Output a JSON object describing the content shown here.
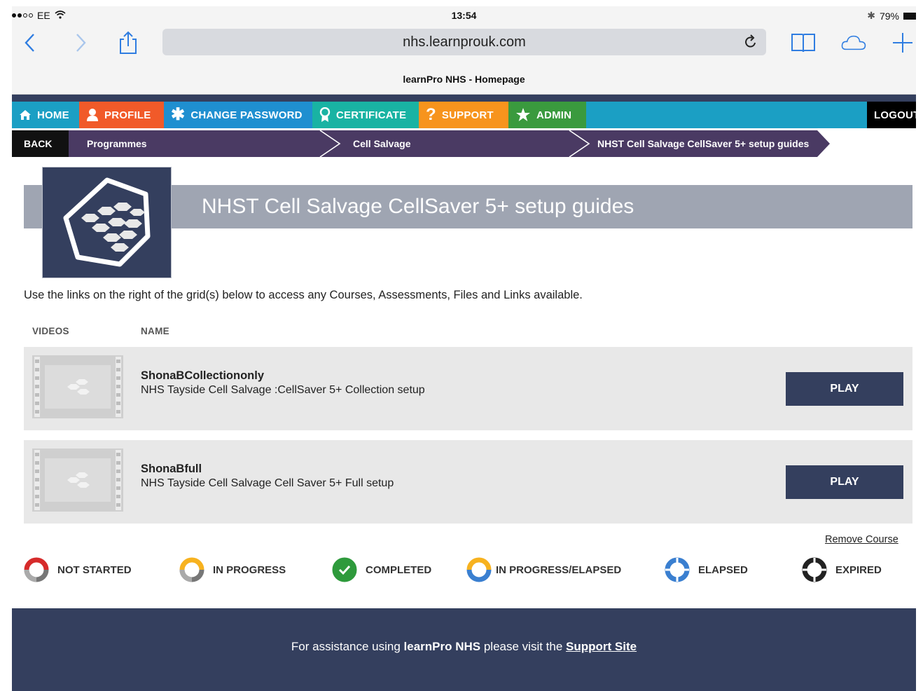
{
  "status_bar": {
    "carrier": "EE",
    "time": "13:54",
    "battery": "79%"
  },
  "browser": {
    "url": "nhs.learnprouk.com",
    "page_title": "learnPro NHS - Homepage"
  },
  "nav": {
    "items": [
      {
        "label": "HOME",
        "icon": "home-icon",
        "color": "#1b9fc4"
      },
      {
        "label": "PROFILE",
        "icon": "user-icon",
        "color": "#f15a29"
      },
      {
        "label": "CHANGE PASSWORD",
        "icon": "asterisk-icon",
        "color": "#1f8fd0"
      },
      {
        "label": "CERTIFICATE",
        "icon": "award-icon",
        "color": "#19b3a3"
      },
      {
        "label": "SUPPORT",
        "icon": "question-icon",
        "color": "#f7941d"
      },
      {
        "label": "ADMIN",
        "icon": "star-icon",
        "color": "#3a9a3e"
      }
    ],
    "logout": "LOGOUT"
  },
  "breadcrumb": {
    "back": "BACK",
    "items": [
      "Programmes",
      "Cell Salvage",
      "NHST Cell Salvage CellSaver 5+ setup guides"
    ]
  },
  "header": {
    "title": "NHST Cell Salvage CellSaver 5+ setup guides"
  },
  "intro": "Use the links on the right of the grid(s) below to access any Courses, Assessments, Files and Links available.",
  "grid": {
    "columns": [
      "VIDEOS",
      "NAME"
    ],
    "rows": [
      {
        "title": "ShonaBCollectiononly",
        "description": "NHS Tayside Cell Salvage :CellSaver 5+ Collection setup",
        "action": "PLAY"
      },
      {
        "title": "ShonaBfull",
        "description": "NHS Tayside Cell Salvage Cell Saver 5+ Full setup",
        "action": "PLAY"
      }
    ]
  },
  "remove_course": "Remove Course",
  "legend": [
    {
      "label": "NOT STARTED",
      "colors": [
        "#d62b2b",
        "#777777"
      ]
    },
    {
      "label": "IN PROGRESS",
      "colors": [
        "#f7b21f",
        "#777777"
      ]
    },
    {
      "label": "COMPLETED",
      "colors": [
        "#2e9a3c",
        "#2e9a3c"
      ]
    },
    {
      "label": "IN PROGRESS/ELAPSED",
      "colors": [
        "#f7b21f",
        "#3a7fd0"
      ]
    },
    {
      "label": "ELAPSED",
      "colors": [
        "#3a7fd0",
        "#3a7fd0"
      ]
    },
    {
      "label": "EXPIRED",
      "colors": [
        "#222222",
        "#222222"
      ]
    }
  ],
  "footer": {
    "prefix": "For assistance using ",
    "brand": "learnPro NHS",
    "middle": " please visit the ",
    "link": "Support Site"
  }
}
